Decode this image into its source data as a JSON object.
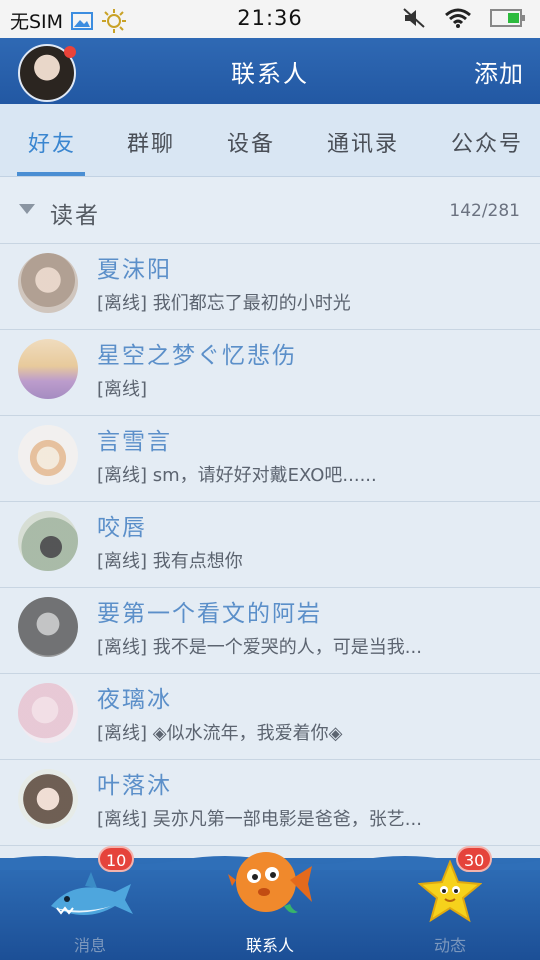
{
  "status_bar": {
    "carrier": "无SIM",
    "time": "21:36"
  },
  "header": {
    "title": "联系人",
    "add_label": "添加"
  },
  "tabs": [
    {
      "label": "好友",
      "active": true
    },
    {
      "label": "群聊",
      "active": false
    },
    {
      "label": "设备",
      "active": false
    },
    {
      "label": "通讯录",
      "active": false
    },
    {
      "label": "公众号",
      "active": false
    }
  ],
  "group": {
    "name": "读者",
    "count": "142/281"
  },
  "contacts": [
    {
      "name": "夏沫阳",
      "status": "[离线] 我们都忘了最初的小时光"
    },
    {
      "name": "星空之梦ぐ忆悲伤",
      "status": "[离线]"
    },
    {
      "name": "言雪言",
      "status": "[离线] sm，请好好对戴EXO吧......"
    },
    {
      "name": "咬唇",
      "status": "[离线] 我有点想你"
    },
    {
      "name": "要第一个看文的阿岩",
      "status": "[离线] 我不是一个爱哭的人，可是当我..."
    },
    {
      "name": "夜璃冰",
      "status": "[离线] ◈似水流年，我爱着你◈"
    },
    {
      "name": "叶落沐",
      "status": "[离线] 吴亦凡第一部电影是爸爸，张艺..."
    }
  ],
  "bottom_nav": [
    {
      "label": "消息",
      "badge": "10",
      "icon": "shark-icon",
      "active": false
    },
    {
      "label": "联系人",
      "badge": "",
      "icon": "fish-icon",
      "active": true
    },
    {
      "label": "动态",
      "badge": "30",
      "icon": "starfish-icon",
      "active": false
    }
  ]
}
